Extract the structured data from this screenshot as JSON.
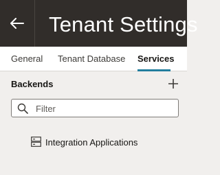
{
  "header": {
    "title": "Tenant Settings"
  },
  "tabs": [
    {
      "label": "General"
    },
    {
      "label": "Tenant Database"
    },
    {
      "label": "Services"
    }
  ],
  "backends": {
    "title": "Backends",
    "filter_placeholder": "Filter",
    "filter_value": "",
    "items": [
      {
        "label": "Integration Applications",
        "icon": "server-icon"
      }
    ]
  },
  "colors": {
    "header_bg": "#312d2a",
    "active_tab_underline": "#227e9e",
    "page_bg": "#f1efed"
  }
}
